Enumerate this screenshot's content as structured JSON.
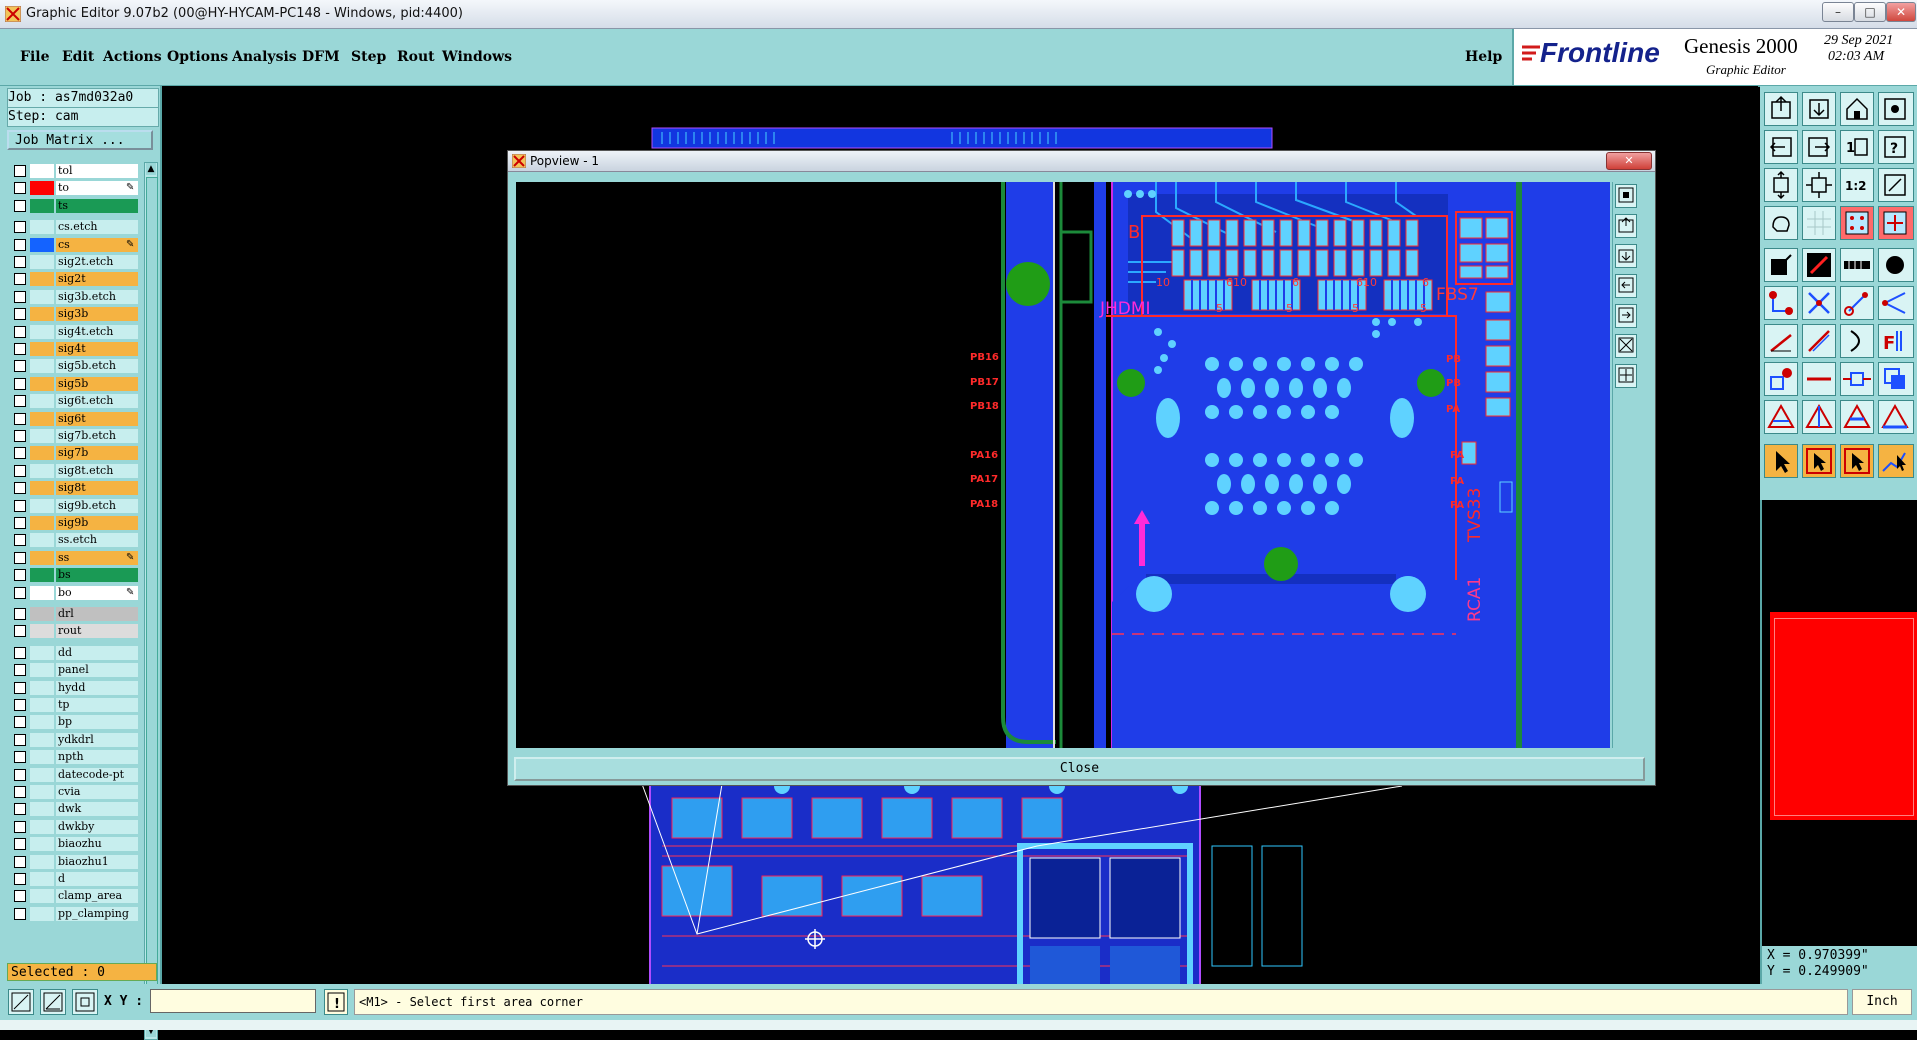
{
  "window": {
    "title": "Graphic Editor 9.07b2 (00@HY-HYCAM-PC148 - Windows, pid:4400)"
  },
  "menu": [
    "File",
    "Edit",
    "Actions",
    "Options",
    "Analysis",
    "DFM",
    "Step",
    "Rout",
    "Windows"
  ],
  "help_label": "Help",
  "brand": {
    "logo": "Frontline",
    "product": "Genesis 2000",
    "subtitle": "Graphic Editor",
    "date": "29 Sep 2021",
    "time": "02:03 AM"
  },
  "job": {
    "job_line": "Job : as7md032a0",
    "step_line": "Step: cam",
    "matrix_label": "Job Matrix ..."
  },
  "layers": [
    {
      "name": "tol",
      "swatch": "#ffffff",
      "bg": "#ffffff"
    },
    {
      "name": "to",
      "swatch": "#ff0000",
      "bg": "#ffffff",
      "mark": true
    },
    {
      "name": "ts",
      "swatch": "#1a9a55",
      "bg": "#1a9a55"
    },
    {
      "name": "cs.etch",
      "swatch": "#c7eeee",
      "bg": "#c7eeee"
    },
    {
      "name": "cs",
      "swatch": "#1463ff",
      "bg": "#f5b342",
      "mark": true
    },
    {
      "name": "sig2t.etch",
      "swatch": "#c7eeee",
      "bg": "#c7eeee"
    },
    {
      "name": "sig2t",
      "swatch": "#f5b342",
      "bg": "#f5b342"
    },
    {
      "name": "sig3b.etch",
      "swatch": "#c7eeee",
      "bg": "#c7eeee"
    },
    {
      "name": "sig3b",
      "swatch": "#f5b342",
      "bg": "#f5b342"
    },
    {
      "name": "sig4t.etch",
      "swatch": "#c7eeee",
      "bg": "#c7eeee"
    },
    {
      "name": "sig4t",
      "swatch": "#f5b342",
      "bg": "#f5b342"
    },
    {
      "name": "sig5b.etch",
      "swatch": "#c7eeee",
      "bg": "#c7eeee"
    },
    {
      "name": "sig5b",
      "swatch": "#f5b342",
      "bg": "#f5b342"
    },
    {
      "name": "sig6t.etch",
      "swatch": "#c7eeee",
      "bg": "#c7eeee"
    },
    {
      "name": "sig6t",
      "swatch": "#f5b342",
      "bg": "#f5b342"
    },
    {
      "name": "sig7b.etch",
      "swatch": "#c7eeee",
      "bg": "#c7eeee"
    },
    {
      "name": "sig7b",
      "swatch": "#f5b342",
      "bg": "#f5b342"
    },
    {
      "name": "sig8t.etch",
      "swatch": "#c7eeee",
      "bg": "#c7eeee"
    },
    {
      "name": "sig8t",
      "swatch": "#f5b342",
      "bg": "#f5b342"
    },
    {
      "name": "sig9b.etch",
      "swatch": "#c7eeee",
      "bg": "#c7eeee"
    },
    {
      "name": "sig9b",
      "swatch": "#f5b342",
      "bg": "#f5b342"
    },
    {
      "name": "ss.etch",
      "swatch": "#c7eeee",
      "bg": "#c7eeee"
    },
    {
      "name": "ss",
      "swatch": "#f5b342",
      "bg": "#f5b342",
      "mark": true
    },
    {
      "name": "bs",
      "swatch": "#1a9a55",
      "bg": "#1a9a55"
    },
    {
      "name": "bo",
      "swatch": "#ffffff",
      "bg": "#ffffff",
      "mark": true
    },
    {
      "name": "drl",
      "swatch": "#c0c0c0",
      "bg": "#c0c0c0"
    },
    {
      "name": "rout",
      "swatch": "#dcdcdc",
      "bg": "#dcdcdc"
    },
    {
      "name": "dd",
      "swatch": "#c7eeee",
      "bg": "#c7eeee"
    },
    {
      "name": "panel",
      "swatch": "#c7eeee",
      "bg": "#c7eeee"
    },
    {
      "name": "hydd",
      "swatch": "#c7eeee",
      "bg": "#c7eeee"
    },
    {
      "name": "tp",
      "swatch": "#c7eeee",
      "bg": "#c7eeee"
    },
    {
      "name": "bp",
      "swatch": "#c7eeee",
      "bg": "#c7eeee"
    },
    {
      "name": "ydkdrl",
      "swatch": "#c7eeee",
      "bg": "#c7eeee"
    },
    {
      "name": "npth",
      "swatch": "#c7eeee",
      "bg": "#c7eeee"
    },
    {
      "name": "datecode-pt",
      "swatch": "#c7eeee",
      "bg": "#c7eeee"
    },
    {
      "name": "cvia",
      "swatch": "#c7eeee",
      "bg": "#c7eeee"
    },
    {
      "name": "dwk",
      "swatch": "#c7eeee",
      "bg": "#c7eeee"
    },
    {
      "name": "dwkby",
      "swatch": "#c7eeee",
      "bg": "#c7eeee"
    },
    {
      "name": "biaozhu",
      "swatch": "#c7eeee",
      "bg": "#c7eeee"
    },
    {
      "name": "biaozhu1",
      "swatch": "#c7eeee",
      "bg": "#c7eeee"
    },
    {
      "name": "d",
      "swatch": "#c7eeee",
      "bg": "#c7eeee"
    },
    {
      "name": "clamp_area",
      "swatch": "#c7eeee",
      "bg": "#c7eeee"
    },
    {
      "name": "pp_clamping",
      "swatch": "#c7eeee",
      "bg": "#c7eeee"
    }
  ],
  "selected_label": "Selected : 0",
  "xy_label": "X Y :",
  "xy_value": "",
  "prompt": "<M1> - Select first area corner",
  "units": "Inch",
  "coords": {
    "x": "X = 0.970399\"",
    "y": "Y = 0.249909\""
  },
  "popview": {
    "title": "Popview - 1",
    "close_label": "Close",
    "labels": {
      "jhdmi": "JHDMI",
      "fbs7": "FBS7",
      "tvs33": "TVS33",
      "rca1": "RCA1",
      "b": "B",
      "pb16": "PB16",
      "pb17": "PB17",
      "pb18": "PB18",
      "pa16": "PA16",
      "pa17": "PA17",
      "pa18": "PA18",
      "n10a": "10",
      "n610a": "610",
      "n6a": "6",
      "n610b": "610",
      "n6b": "6",
      "n5a": "5",
      "n5b": "5",
      "n5c": "5",
      "n5d": "5",
      "pb1": "PB",
      "pb2": "PB",
      "pa1": "PA",
      "pa2": "PA",
      "pa3": "PA",
      "pa4": "PA"
    }
  }
}
